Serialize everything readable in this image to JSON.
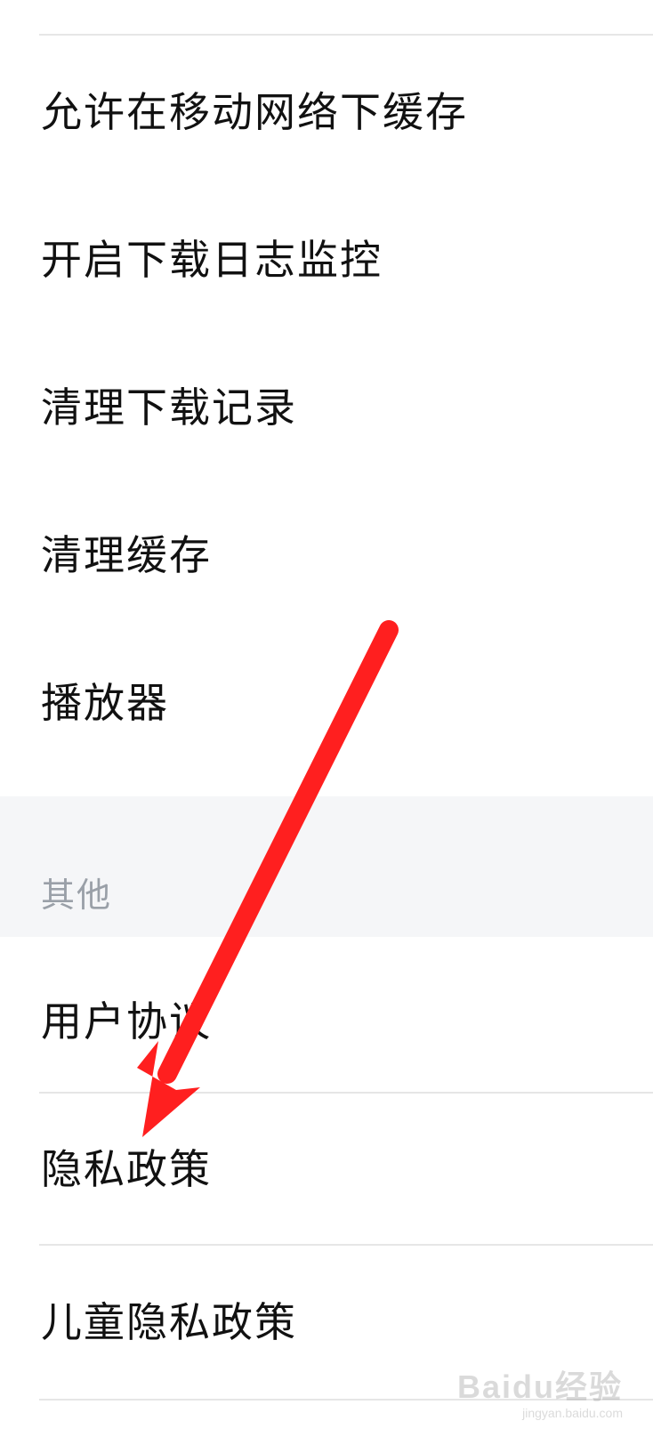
{
  "settings": {
    "items_top": [
      {
        "label": "允许在移动网络下缓存"
      },
      {
        "label": "开启下载日志监控"
      },
      {
        "label": "清理下载记录"
      },
      {
        "label": "清理缓存"
      },
      {
        "label": "播放器"
      }
    ],
    "section_other": {
      "label": "其他"
    },
    "items_bottom": [
      {
        "label": "用户协议"
      },
      {
        "label": "隐私政策"
      },
      {
        "label": "儿童隐私政策"
      }
    ]
  },
  "annotation": {
    "arrow_color": "#ff1f1f"
  },
  "watermark": {
    "logo": "Baidu经验",
    "url": "jingyan.baidu.com"
  }
}
